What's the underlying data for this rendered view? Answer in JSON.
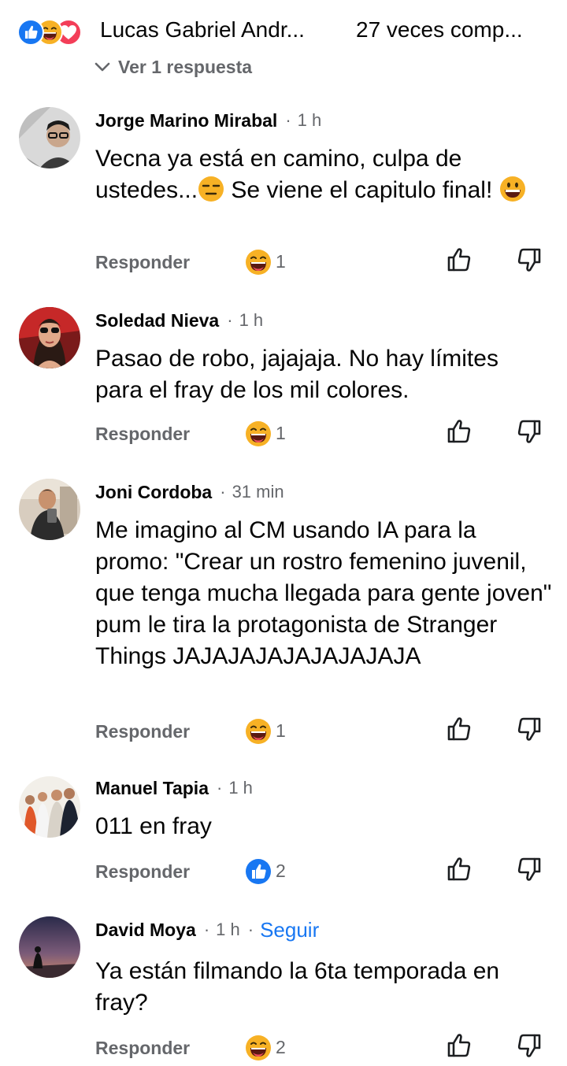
{
  "header": {
    "reactions": [
      "like-icon",
      "haha-icon",
      "love-icon"
    ],
    "name": "Lucas Gabriel Andr...",
    "shares": "27 veces comp...",
    "view_replies": "Ver 1 respuesta"
  },
  "colors": {
    "like": "#1877f2",
    "haha": "#f7b125",
    "love": "#f33e58",
    "follow": "#1877f2",
    "meta": "#65676b"
  },
  "comments": [
    {
      "author": "Jorge Marino Mirabal",
      "dot": "·",
      "time": "1 h",
      "text": "Vecna ya está en camino, culpa de ustedes...",
      "text_emoji": "expressionless-face-emoji",
      "text_after": " Se viene el capitulo final! ",
      "text_emoji2": "grinning-face-emoji",
      "reply": "Responder",
      "reaction_icon": "haha-icon",
      "reaction_count": "1"
    },
    {
      "author": "Soledad Nieva",
      "dot": "·",
      "time": "1 h",
      "text": "Pasao de robo, jajajaja. No hay límites para el fray de los mil colores.",
      "reply": "Responder",
      "reaction_icon": "haha-icon",
      "reaction_count": "1"
    },
    {
      "author": "Joni Cordoba",
      "dot": "·",
      "time": "31 min",
      "text": "Me imagino al CM usando IA para la promo: \"Crear un rostro femenino juvenil, que tenga mucha llegada para gente joven\" pum le tira la protagonista de Stranger Things JAJAJAJAJAJAJAJAJA",
      "reply": "Responder",
      "reaction_icon": "haha-icon",
      "reaction_count": "1"
    },
    {
      "author": "Manuel Tapia",
      "dot": "·",
      "time": "1 h",
      "text": "011 en fray",
      "reply": "Responder",
      "reaction_icon": "like-icon",
      "reaction_count": "2"
    },
    {
      "author": "David Moya",
      "dot": "·",
      "time": "1 h",
      "dot2": "·",
      "follow": "Seguir",
      "text": "Ya están filmando la 6ta temporada en fray?",
      "reply": "Responder",
      "reaction_icon": "haha-icon",
      "reaction_count": "2"
    }
  ]
}
